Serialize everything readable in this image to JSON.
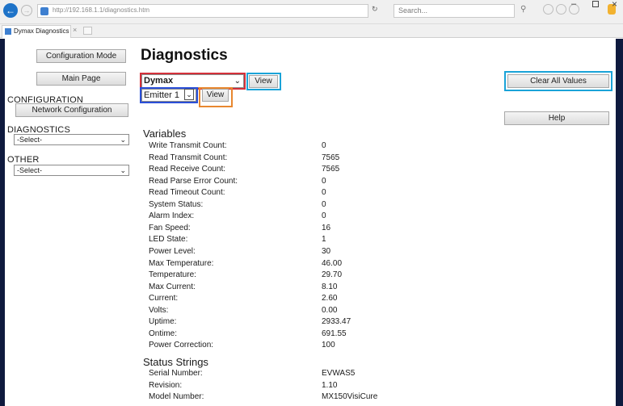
{
  "browser": {
    "address": "http://192.168.1.1/diagnostics.htm",
    "search_placeholder": "Search...",
    "tab_title": "Dymax Diagnostics"
  },
  "sidebar": {
    "config_mode_label": "Configuration Mode",
    "main_page_label": "Main Page",
    "configuration_heading": "CONFIGURATION",
    "network_config_label": "Network Configuration",
    "diagnostics_heading": "DIAGNOSTICS",
    "diagnostics_select": "-Select-",
    "other_heading": "OTHER",
    "other_select": "-Select-"
  },
  "main": {
    "title": "Diagnostics",
    "device_select": "Dymax",
    "view_label": "View",
    "emitter_select": "Emitter 1",
    "emitter_view_label": "View",
    "clear_label": "Clear All Values",
    "help_label": "Help"
  },
  "variables": {
    "heading": "Variables",
    "rows": [
      {
        "label": "Write Transmit Count:",
        "value": "0"
      },
      {
        "label": "Read Transmit Count:",
        "value": "7565"
      },
      {
        "label": "Read Receive Count:",
        "value": "7565"
      },
      {
        "label": "Read Parse Error Count:",
        "value": "0"
      },
      {
        "label": "Read Timeout Count:",
        "value": "0"
      },
      {
        "label": "System Status:",
        "value": "0"
      },
      {
        "label": "Alarm Index:",
        "value": "0"
      },
      {
        "label": "Fan Speed:",
        "value": "16"
      },
      {
        "label": "LED State:",
        "value": "1"
      },
      {
        "label": "Power Level:",
        "value": "30"
      },
      {
        "label": "Max Temperature:",
        "value": "46.00"
      },
      {
        "label": "Temperature:",
        "value": "29.70"
      },
      {
        "label": "Max Current:",
        "value": "8.10"
      },
      {
        "label": "Current:",
        "value": "2.60"
      },
      {
        "label": "Volts:",
        "value": "0.00"
      },
      {
        "label": "Uptime:",
        "value": "2933.47"
      },
      {
        "label": "Ontime:",
        "value": "691.55"
      },
      {
        "label": "Power Correction:",
        "value": "100"
      }
    ]
  },
  "status_strings": {
    "heading": "Status Strings",
    "rows": [
      {
        "label": "Serial Number:",
        "value": "EVWAS5"
      },
      {
        "label": "Revision:",
        "value": "1.10"
      },
      {
        "label": "Model Number:",
        "value": "MX150VisiCure"
      }
    ]
  }
}
